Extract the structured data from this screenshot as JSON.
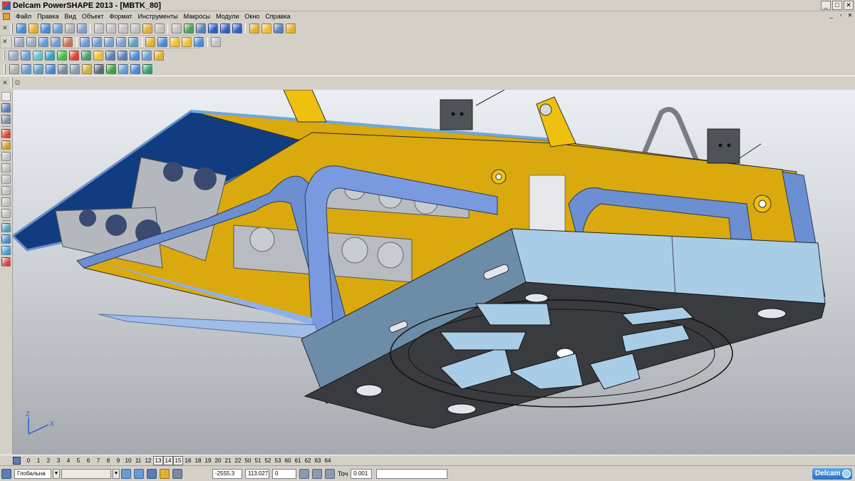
{
  "window": {
    "title": "Delcam PowerSHAPE 2013 - [MBTK_80]",
    "min": "_",
    "max": "□",
    "close": "✕"
  },
  "menu": [
    "Файл",
    "Правка",
    "Вид",
    "Объект",
    "Формат",
    "Инструменты",
    "Макросы",
    "Модули",
    "Окно",
    "Справка"
  ],
  "mdi": {
    "min": "_",
    "restore": "▫",
    "close": "✕"
  },
  "toolbars": {
    "row1_colors": [
      "#4a8ad6",
      "#e0b030",
      "#4a8ad6",
      "#6a9ad6",
      "#b0b0b0",
      "#7aa0d0",
      "#c0c0c0",
      "#c0c0c0",
      "#c0c0c0",
      "#c0c0c0",
      "#e0b030",
      "#c0c0c0",
      "#c0c0c0",
      "#50a050",
      "#5a7fb5",
      "#3060c0",
      "#3060c0",
      "#3060c0",
      "#e0b030",
      "#f0c030",
      "#5a7fb5",
      "#e0b030"
    ],
    "row2_colors": [
      "#9aa8c0",
      "#9aa8c0",
      "#6a9ad6",
      "#6a9ad6",
      "#d07050",
      "#6a9ad6",
      "#6a9ad6",
      "#7aa0d0",
      "#7aa0d0",
      "#60a0c0",
      "#e0b030",
      "#4a8ad6",
      "#f0c030",
      "#f0c030",
      "#4a8ad6",
      "#c0c0c0"
    ],
    "row3_colors": [
      "#9aa8c0",
      "#6a9ad6",
      "#60c0d0",
      "#30a0c0",
      "#40c040",
      "#e04030",
      "#40a070",
      "#f0c030",
      "#5a7fb5",
      "#5a7fb5",
      "#4a8ad6",
      "#6a9ad6",
      "#e0b030"
    ],
    "row4_colors": [
      "#b0b0b0",
      "#6a9ad6",
      "#60a0c0",
      "#4a8ad6",
      "#7a8aa0",
      "#8a9ab0",
      "#d0b040",
      "#5a6a80",
      "#40a040",
      "#6a9ad6",
      "#4a8ad6",
      "#30a070"
    ],
    "close": "✕",
    "pin": "ʘ"
  },
  "left_tool_colors": [
    "#e8e8e8",
    "#5a7fb5",
    "#8090a0",
    "#e04030",
    "#d0a030",
    "#c0c0c0",
    "#c0c0c0",
    "#c0c0c0",
    "#c0c0c0",
    "#c0c0c0",
    "#c0c0c0",
    "#50a0c0",
    "#4a8ad6",
    "#40a0d0",
    "#e04040"
  ],
  "axes": {
    "x": "X",
    "y": "Y",
    "z": "Z"
  },
  "levels": [
    "0",
    "1",
    "2",
    "3",
    "4",
    "5",
    "6",
    "7",
    "8",
    "9",
    "10",
    "11",
    "12",
    "13",
    "14",
    "15",
    "16",
    "18",
    "19",
    "20",
    "21",
    "22",
    "50",
    "51",
    "52",
    "53",
    "60",
    "61",
    "62",
    "63",
    "64"
  ],
  "levels_active": [
    "13",
    "14",
    "15"
  ],
  "status": {
    "workplane": "Глобальна",
    "workplane_drop": "▼",
    "empty_drop": "▼",
    "x": "-2555.3",
    "y": "113.027",
    "z": "0",
    "tolerance_label": "Точ",
    "tolerance": "0.001",
    "brand": "Delcam"
  }
}
